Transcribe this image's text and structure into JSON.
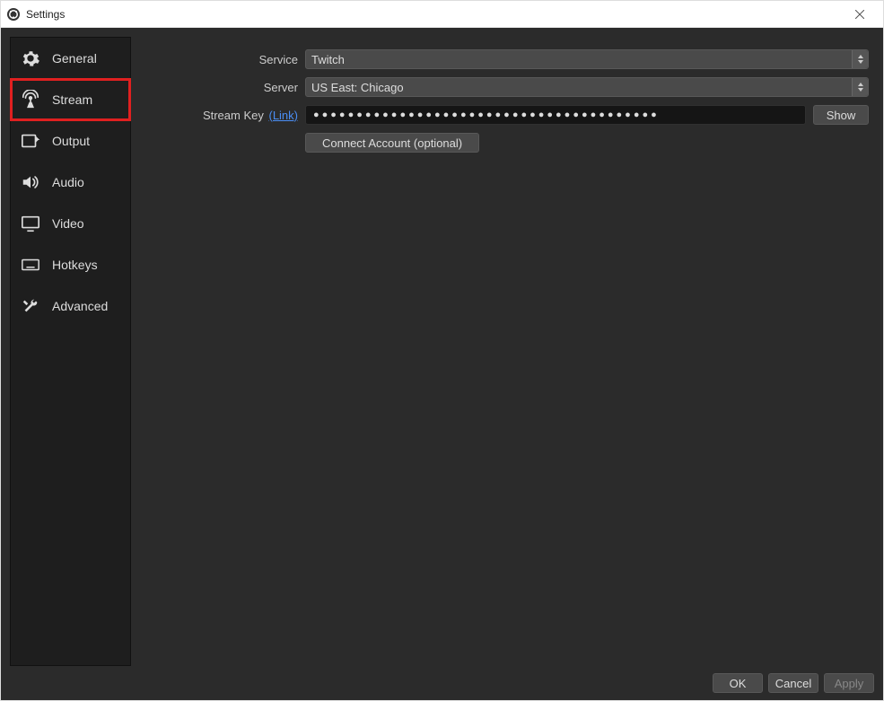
{
  "window": {
    "title": "Settings"
  },
  "sidebar": {
    "items": [
      {
        "label": "General",
        "icon": "gear-icon"
      },
      {
        "label": "Stream",
        "icon": "antenna-icon",
        "highlight": true
      },
      {
        "label": "Output",
        "icon": "output-icon"
      },
      {
        "label": "Audio",
        "icon": "speaker-icon"
      },
      {
        "label": "Video",
        "icon": "monitor-icon"
      },
      {
        "label": "Hotkeys",
        "icon": "keyboard-icon"
      },
      {
        "label": "Advanced",
        "icon": "tools-icon"
      }
    ]
  },
  "form": {
    "service": {
      "label": "Service",
      "value": "Twitch"
    },
    "server": {
      "label": "Server",
      "value": "US East: Chicago"
    },
    "stream_key": {
      "label": "Stream Key",
      "link_text": "(Link)",
      "value": "●●●●●●●●●●●●●●●●●●●●●●●●●●●●●●●●●●●●●●●●",
      "show_btn": "Show"
    },
    "connect_button": "Connect Account (optional)"
  },
  "footer": {
    "ok": "OK",
    "cancel": "Cancel",
    "apply": "Apply"
  }
}
